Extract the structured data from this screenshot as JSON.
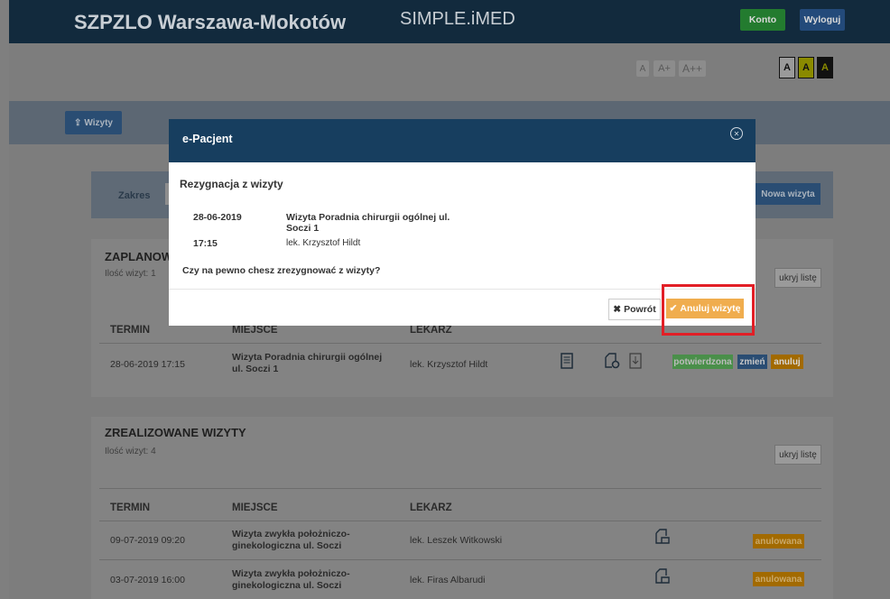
{
  "header": {
    "brand": "SZPZLO Warszawa-Mokotów",
    "product": "SIMPLE.iMED",
    "konto": "Konto",
    "wyloguj": "Wyloguj"
  },
  "font_sizes": [
    "A",
    "A+",
    "A++"
  ],
  "contrast": [
    "A",
    "A",
    "A"
  ],
  "nav": {
    "wizyty": "Wizyty"
  },
  "range": {
    "label": "Zakres",
    "new_visit": "Nowa wizyta"
  },
  "planned": {
    "title": "ZAPLANOWA",
    "count": "Ilość wizyt: 1",
    "hide": "ukryj listę",
    "headers": [
      "TERMIN",
      "MIEJSCE",
      "LEKARZ"
    ],
    "rows": [
      {
        "term": "28-06-2019 17:15",
        "place": "Wizyta Poradnia chirurgii ogólnej ul. Soczi 1",
        "doctor": "lek. Krzysztof Hildt",
        "status": "potwierdzona",
        "change": "zmień",
        "cancel": "anuluj"
      }
    ]
  },
  "done": {
    "title": "ZREALIZOWANE WIZYTY",
    "count": "Ilość wizyt: 4",
    "hide": "ukryj listę",
    "headers": [
      "TERMIN",
      "MIEJSCE",
      "LEKARZ"
    ],
    "rows": [
      {
        "term": "09-07-2019 09:20",
        "place": "Wizyta zwykła położniczo-ginekologiczna ul. Soczi",
        "doctor": "lek. Leszek Witkowski",
        "status": "anulowana"
      },
      {
        "term": "03-07-2019 16:00",
        "place": "Wizyta zwykła położniczo-ginekologiczna ul. Soczi",
        "doctor": "lek. Firas Albarudi",
        "status": "anulowana"
      }
    ]
  },
  "modal": {
    "title": "e-Pacjent",
    "subtitle": "Rezygnacja z wizyty",
    "date": "28-06-2019",
    "time": "17:15",
    "place": "Wizyta Poradnia chirurgii ogólnej ul. Soczi 1",
    "doctor": "lek. Krzysztof Hildt",
    "question": "Czy na pewno chesz zrezygnować z wizyty?",
    "back_label": "Powrót",
    "confirm_label": "Anuluj wizytę"
  },
  "colors": {
    "header_bg": "#122a3d",
    "modal_header": "#173e5f",
    "confirm": "#f0ad4e",
    "highlight": "#e21f26"
  }
}
